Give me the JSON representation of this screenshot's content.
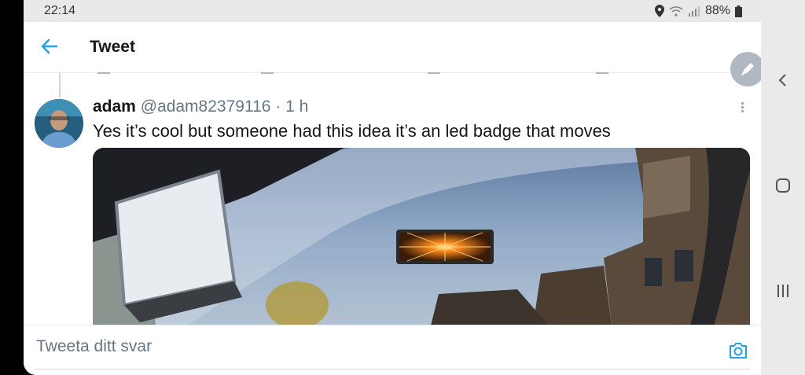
{
  "status_bar": {
    "time": "22:14",
    "battery": "88%"
  },
  "app_bar": {
    "title": "Tweet",
    "back_icon": "arrow-left-icon"
  },
  "tweet": {
    "author_name": "adam",
    "handle": "@adam82379116",
    "separator": "·",
    "time": "1 h",
    "text": "Yes it’s cool but someone had this idea it’s an led badge that moves"
  },
  "reply": {
    "placeholder": "Tweeta ditt svar",
    "camera_icon": "camera-icon"
  },
  "fab": {
    "icon": "pencil-icon"
  },
  "colors": {
    "accent": "#1da1f2",
    "text": "#14171a",
    "secondary": "#657786"
  },
  "nav_bar": {
    "icons": [
      "back-chevron-icon",
      "home-icon",
      "recents-icon"
    ]
  }
}
